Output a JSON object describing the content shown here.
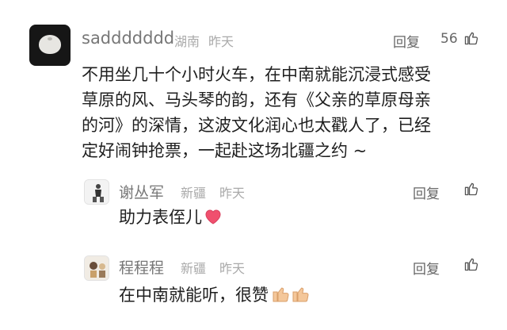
{
  "comments": [
    {
      "username": "saddddddd",
      "location": "湖南",
      "time": "昨天",
      "reply_label": "回复",
      "like_count": "56",
      "text_lines": [
        "不用坐几十个小时火车，在中南就能沉浸式感受",
        "草原的风、马头琴的韵，还有《父亲的草原母亲",
        "的河》的深情，这波文化润心也太戳人了，已经",
        "定好闹钟抢票，一起赴这场北疆之约 ~"
      ],
      "replies": [
        {
          "username": "谢丛军",
          "location": "新疆",
          "time": "昨天",
          "reply_label": "回复",
          "text": "助力表侄儿",
          "emoji": "heart-emoji"
        },
        {
          "username": "程程程",
          "location": "新疆",
          "time": "昨天",
          "reply_label": "回复",
          "text": "在中南就能听，很赞",
          "emoji": "thumbs-up-emoji-pair"
        }
      ]
    }
  ],
  "icons": {
    "like": "thumbs-up-outline-icon",
    "heart": "heart-emoji",
    "thumbs": "thumbs-up-emoji"
  },
  "colors": {
    "heart": "#f0506e",
    "thumbs_emoji": "#f4c79a"
  }
}
